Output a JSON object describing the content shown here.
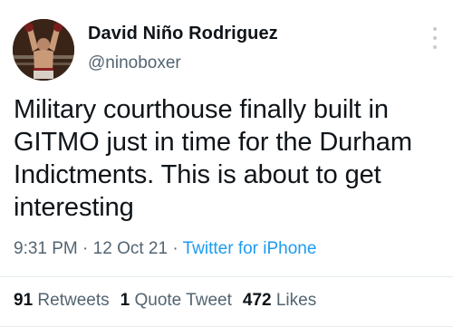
{
  "author": {
    "display_name": "David Niño Rodriguez",
    "handle": "@ninoboxer"
  },
  "tweet": {
    "text": "Military courthouse finally built in GITMO just in time for the Durham Indictments. This is about to get interesting",
    "time": "9:31 PM",
    "separator": "·",
    "date": "12 Oct 21",
    "source": "Twitter for iPhone"
  },
  "stats": {
    "retweets_count": "91",
    "retweets_label": "Retweets",
    "quotes_count": "1",
    "quotes_label": "Quote Tweet",
    "likes_count": "472",
    "likes_label": "Likes"
  },
  "icons": {
    "avatar": "boxer-photo",
    "more": "more-options-icon"
  },
  "colors": {
    "text": "#0f1419",
    "secondary": "#536471",
    "link": "#1d9bf0"
  }
}
